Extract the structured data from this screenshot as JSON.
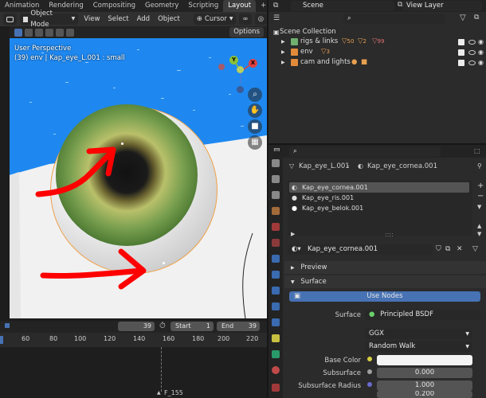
{
  "topbar": {
    "tabs": [
      "Animation",
      "Rendering",
      "Compositing",
      "Geometry Nodes",
      "Scripting",
      "Layout"
    ],
    "active_tab": "Layout",
    "add_tab": "+"
  },
  "viewport_header": {
    "mode": "Object Mode",
    "menus": [
      "View",
      "Select",
      "Add",
      "Object"
    ],
    "transform": "Cursor"
  },
  "viewport": {
    "options_label": "Options",
    "perspective_label": "User Perspective",
    "object_label": "(39) env | Kap_eye_L.001 : small",
    "gizmo": {
      "y": "Y",
      "x": "X"
    }
  },
  "timeline": {
    "current_frame": "39",
    "start_label": "Start",
    "start_value": "1",
    "end_label": "End",
    "end_value": "39",
    "ruler": [
      "60",
      "80",
      "100",
      "120",
      "140",
      "160",
      "180",
      "200",
      "220"
    ],
    "current_marker": "F_155"
  },
  "outliner_header": {
    "scene": "Scene",
    "view_layer": "View Layer"
  },
  "outliner": {
    "root": "Scene Collection",
    "collections": [
      {
        "name": "rigs & links",
        "badges": [
          "50",
          "2",
          "99"
        ]
      },
      {
        "name": "env",
        "badges": [
          "3"
        ]
      },
      {
        "name": "cam and lights",
        "badges": []
      }
    ]
  },
  "properties": {
    "breadcrumb_object": "Kap_eye_L.001",
    "breadcrumb_material": "Kap_eye_cornea.001",
    "slots": [
      "Kap_eye_cornea.001",
      "Kap_eye_ris.001",
      "Kap_eye_belok.001"
    ],
    "selected_slot": 0,
    "material_name": "Kap_eye_cornea.001",
    "sections": {
      "preview": "Preview",
      "surface": "Surface"
    },
    "use_nodes": "Use Nodes",
    "surface_label": "Surface",
    "surface_value": "Principled BSDF",
    "distribution": "GGX",
    "subsurface_method": "Random Walk",
    "fields": [
      {
        "label": "Base Color",
        "value": ""
      },
      {
        "label": "Subsurface",
        "value": "0.000"
      },
      {
        "label": "Subsurface Radius",
        "value": "1.000"
      }
    ],
    "extra_value": "0.200"
  },
  "colors": {
    "viewport_sky": "#1e88f0",
    "accent_blue": "#4772b3",
    "selected_outline": "#f0a24a",
    "annotation_red": "#ff0000"
  }
}
